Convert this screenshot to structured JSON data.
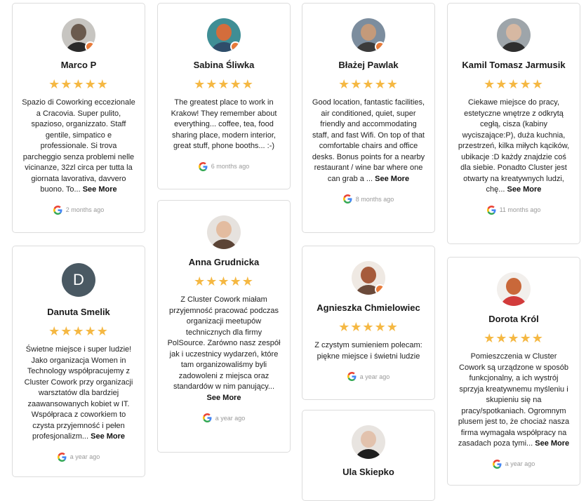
{
  "reviews": [
    {
      "name": "Marco P",
      "stars": "★★★★★",
      "text": "Spazio di Coworking eccezionale a Cracovia. Super pulito, spazioso, organizzato. Staff gentile, simpatico e professionale. Si trova parcheggio senza problemi nelle vicinanze, 32zl circa per tutta la giornata lavorativa, davvero buono. To...",
      "see_more": "See More",
      "time": "2 months ago"
    },
    {
      "name": "Danuta Smelik",
      "initial": "D",
      "stars": "★★★★★",
      "text": "Świetne miejsce i super ludzie! Jako organizacja Women in Technology współpracujemy z Cluster Cowork przy organizacji warsztatów dla bardziej zaawansowanych kobiet w IT. Współpraca z coworkiem to czysta przyjemność i pełen profesjonalizm...",
      "see_more": "See More",
      "time": "a year ago"
    },
    {
      "name": "Sabina Śliwka",
      "stars": "★★★★★",
      "text": "The greatest place to work in Krakow! They remember about everything... coffee, tea, food sharing place, modern interior, great stuff, phone booths... :-)",
      "time": "6 months ago"
    },
    {
      "name": "Anna Grudnicka",
      "stars": "★★★★★",
      "text": "Z Cluster Cowork miałam przyjemność pracować podczas organizacji meetupów technicznych dla firmy PolSource. Zarówno nasz zespół jak i uczestnicy wydarzeń, które tam organizowaliśmy byli zadowoleni z miejsca oraz standardów w nim panujący...",
      "see_more": "See More",
      "time": "a year ago"
    },
    {
      "name": "Błażej Pawlak",
      "stars": "★★★★★",
      "text": "Good location, fantastic facilities, air conditioned, quiet, super friendly and accommodating staff, and fast Wifi. On top of that comfortable chairs and office desks. Bonus points for a nearby restaurant / wine bar where one can grab a ...",
      "see_more": "See More",
      "time": "8 months ago"
    },
    {
      "name": "Agnieszka Chmielowiec",
      "stars": "★★★★★",
      "text": "Z czystym sumieniem polecam: piękne miejsce i świetni ludzie",
      "time": "a year ago"
    },
    {
      "name": "Ula Skiepko"
    },
    {
      "name": "Kamil Tomasz Jarmusik",
      "stars": "★★★★★",
      "text": "Ciekawe miejsce do pracy, estetyczne wnętrze z odkrytą cegłą, cisza (kabiny wyciszające:P), duża kuchnia, przestrzeń, kilka miłych kącików, ubikacje :D każdy znajdzie coś dla siebie. Ponadto Cluster jest otwarty na kreatywnych ludzi, chę...",
      "see_more": "See More",
      "time": "11 months ago"
    },
    {
      "name": "Dorota Król",
      "stars": "★★★★★",
      "text": "Pomieszczenia w Cluster Cowork są urządzone w sposób funkcjonalny, a ich wystrój sprzyja kreatywnemu myśleniu i skupieniu się na pracy/spotkaniach. Ogromnym plusem jest to, że chociaż nasza firma wymagała współpracy na zasadach poza tymi...",
      "see_more": "See More",
      "time": "a year ago"
    }
  ]
}
